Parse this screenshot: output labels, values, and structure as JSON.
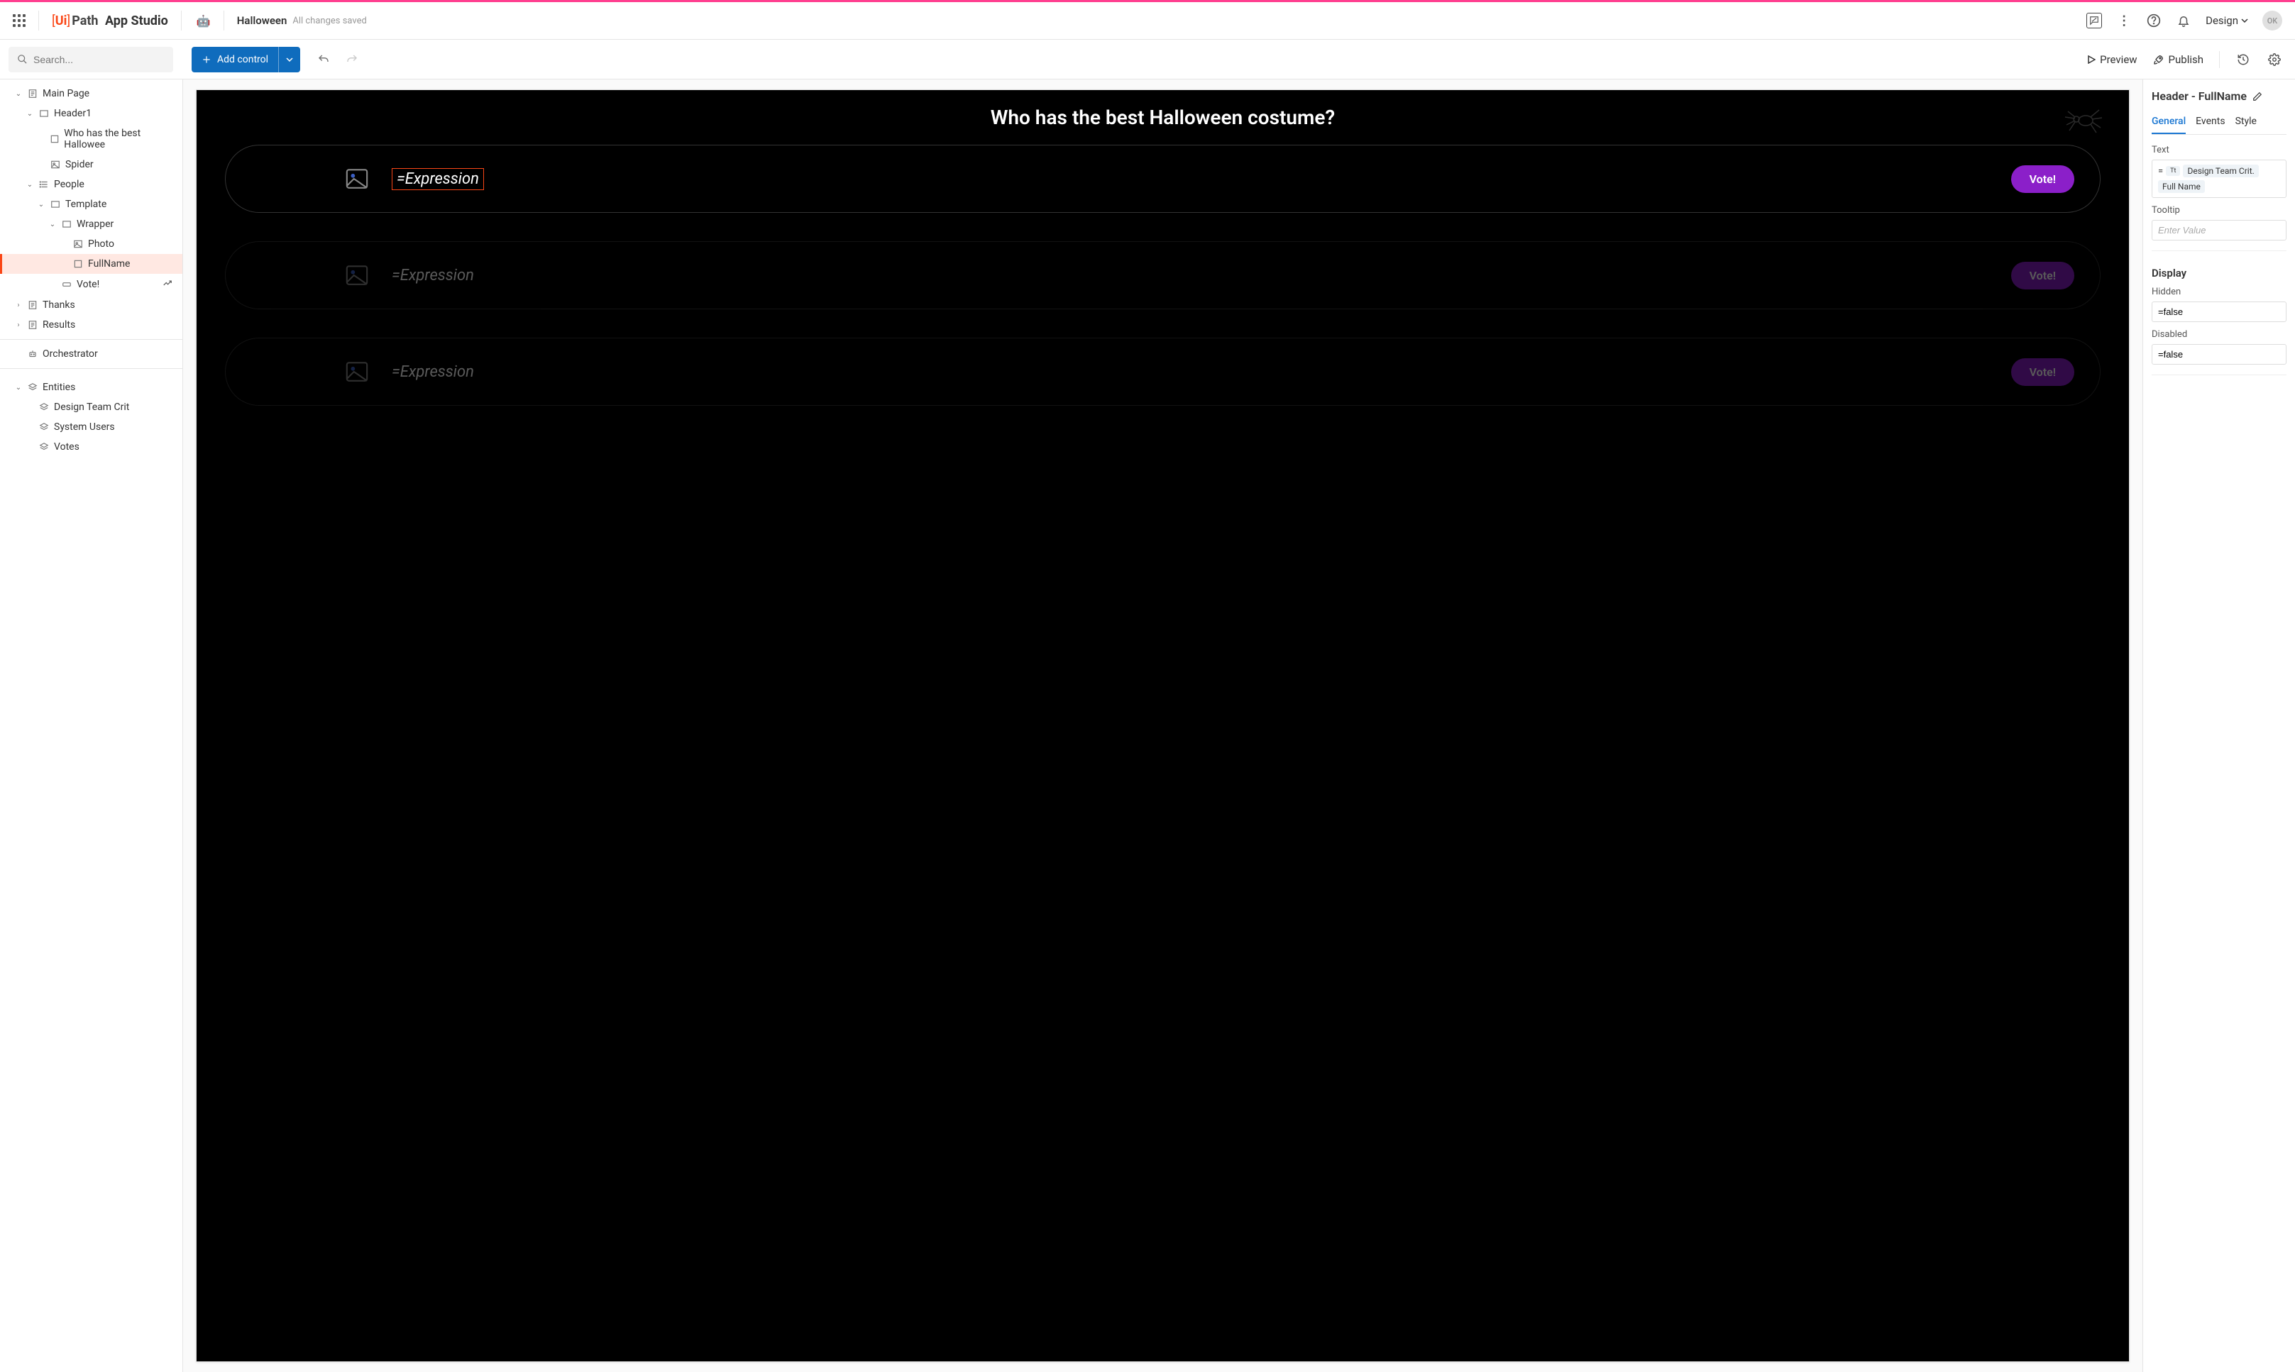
{
  "topbar": {
    "logo_ui": "Ui",
    "logo_path": "Path",
    "app_studio": "App Studio",
    "app_name": "Halloween",
    "saved_status": "All changes saved",
    "design_label": "Design",
    "avatar": "OK"
  },
  "actionbar": {
    "search_placeholder": "Search...",
    "add_control": "Add control",
    "preview": "Preview",
    "publish": "Publish"
  },
  "tree": {
    "main_page": "Main Page",
    "header1": "Header1",
    "who": "Who has the best Hallowee",
    "spider": "Spider",
    "people": "People",
    "template": "Template",
    "wrapper": "Wrapper",
    "photo": "Photo",
    "fullname": "FullName",
    "vote": "Vote!",
    "thanks": "Thanks",
    "results": "Results",
    "orchestrator": "Orchestrator",
    "entities": "Entities",
    "entity1": "Design Team Crit",
    "entity2": "System Users",
    "entity3": "Votes"
  },
  "canvas": {
    "title": "Who has the best Halloween costume?",
    "expression": "=Expression",
    "vote": "Vote!"
  },
  "panel": {
    "header": "Header - FullName",
    "tab_general": "General",
    "tab_events": "Events",
    "tab_style": "Style",
    "text_label": "Text",
    "text_chip1": "Design Team Crit.",
    "text_chip2": "Full Name",
    "eq": "=",
    "tt_icon": "Tt",
    "tooltip_label": "Tooltip",
    "tooltip_placeholder": "Enter Value",
    "display_label": "Display",
    "hidden_label": "Hidden",
    "hidden_value": "=false",
    "disabled_label": "Disabled",
    "disabled_value": "=false"
  }
}
